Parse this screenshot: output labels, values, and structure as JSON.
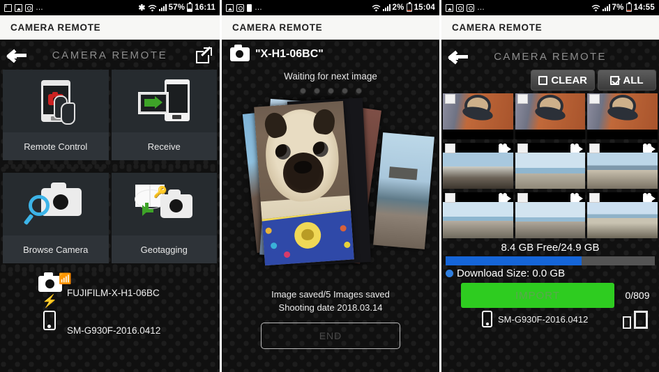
{
  "panel1": {
    "statusbar": {
      "left_icons": [
        "mail-icon",
        "gallery-icon",
        "instagram-icon",
        "more-icon"
      ],
      "bluetooth": "bluetooth-icon",
      "wifi": "wifi-icon",
      "signal": "signal-icon",
      "battery_pct": "57%",
      "time": "16:11"
    },
    "appbar_title": "CAMERA REMOTE",
    "header": {
      "back": "back-arrow",
      "title": "CAMERA REMOTE",
      "share": "external-link-icon"
    },
    "tiles": [
      {
        "label": "Remote Control",
        "icon": "phone-camera-tap-icon"
      },
      {
        "label": "Receive",
        "icon": "transfer-to-phone-icon"
      },
      {
        "label": "Browse Camera",
        "icon": "camera-magnifier-icon"
      },
      {
        "label": "Geotagging",
        "icon": "geotag-camera-icon"
      }
    ],
    "devices": {
      "camera": "FUJIFILM-X-H1-06BC",
      "phone": "SM-G930F-2016.0412"
    }
  },
  "panel2": {
    "statusbar": {
      "left_icons": [
        "gallery-icon",
        "instagram-icon",
        "battery-icon",
        "more-icon"
      ],
      "wifi": "wifi-icon",
      "signal": "signal-icon",
      "battery_pct": "2%",
      "time": "15:04"
    },
    "appbar_title": "CAMERA REMOTE",
    "camera_name": "\"X-H1-06BC\"",
    "waiting_text": "Waiting for next image",
    "dots_count": 5,
    "status_line1": "Image saved/5 Images saved",
    "status_line2": "Shooting date 2018.03.14",
    "end_button": "END"
  },
  "panel3": {
    "statusbar": {
      "left_icons": [
        "gallery-icon",
        "instagram-icon",
        "instagram-icon",
        "more-icon"
      ],
      "wifi": "wifi-icon",
      "signal": "signal-icon",
      "battery_pct": "7%",
      "time": "14:55"
    },
    "appbar_title": "CAMERA REMOTE",
    "header": {
      "back": "back-arrow",
      "title": "CAMERA REMOTE"
    },
    "buttons": {
      "clear": "CLEAR",
      "all": "ALL"
    },
    "grid": [
      [
        {
          "kind": "coffee",
          "video": false
        },
        {
          "kind": "coffee",
          "video": false
        },
        {
          "kind": "coffee",
          "video": false
        }
      ],
      [
        {
          "kind": "town",
          "video": true
        },
        {
          "kind": "sea",
          "video": true
        },
        {
          "kind": "city",
          "video": true
        }
      ],
      [
        {
          "kind": "beach",
          "video": true
        },
        {
          "kind": "beach2",
          "video": true
        },
        {
          "kind": "beach3",
          "video": true
        }
      ]
    ],
    "storage_text": "8.4 GB Free/24.9 GB",
    "storage_fill_pct": 65,
    "download_size": "Download Size: 0.0 GB",
    "import_button": "IMPORT",
    "count": "0/809",
    "device_name": "SM-G930F-2016.0412",
    "accent_blue": "#1565d8",
    "accent_green": "#2ecc20"
  }
}
